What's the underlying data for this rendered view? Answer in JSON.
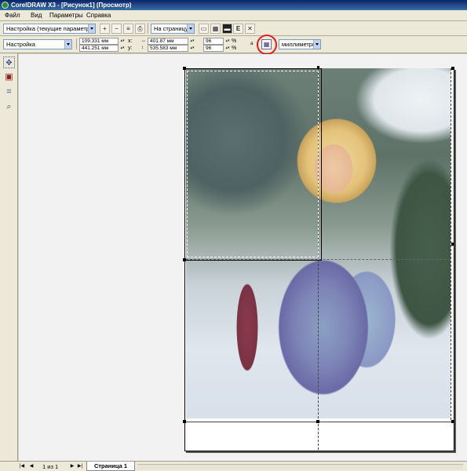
{
  "window": {
    "title": "CorelDRAW X3 - [Рисунок1] (Просмотр)"
  },
  "menu": [
    {
      "label": "Файл"
    },
    {
      "label": "Вид"
    },
    {
      "label": "Параметры"
    },
    {
      "label": "Справка"
    }
  ],
  "toolbar1": {
    "preset": "Настройка (текущие параметры",
    "fit": "На страницу"
  },
  "toolbar2": {
    "preset": "Настройка",
    "x": "109.331 мм",
    "y": "441.251 мм",
    "width": "401.87 мм",
    "height": "535.583 мм",
    "scale_x": "96",
    "scale_y": "96",
    "percent": "%",
    "x_label": "x:",
    "y_label": "y:",
    "units": "миллиметры"
  },
  "status": {
    "page_count": "1 из 1",
    "page_tab": "Страница 1"
  }
}
